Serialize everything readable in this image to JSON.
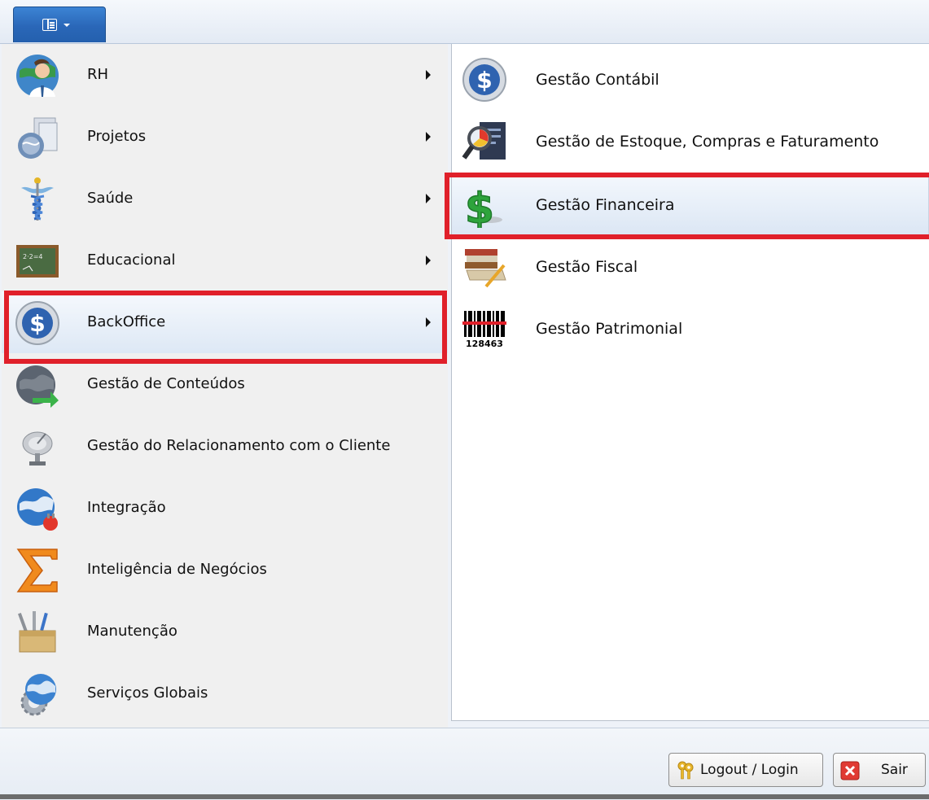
{
  "main_menu": {
    "items": [
      {
        "label": "RH",
        "icon": "rh-person-globe-icon",
        "has_submenu": true
      },
      {
        "label": "Projetos",
        "icon": "projetos-globe-documents-icon",
        "has_submenu": true
      },
      {
        "label": "Saúde",
        "icon": "saude-caduceus-icon",
        "has_submenu": true
      },
      {
        "label": "Educacional",
        "icon": "educacional-chalkboard-icon",
        "has_submenu": true
      },
      {
        "label": "BackOffice",
        "icon": "backoffice-dollar-icon",
        "has_submenu": true,
        "selected": true
      },
      {
        "label": "Gestão de Conteúdos",
        "icon": "conteudos-globe-arrow-icon",
        "has_submenu": false
      },
      {
        "label": "Gestão do Relacionamento com o Cliente",
        "icon": "crm-satellite-dish-icon",
        "has_submenu": false
      },
      {
        "label": "Integração",
        "icon": "integracao-globe-plug-icon",
        "has_submenu": false
      },
      {
        "label": "Inteligência de Negócios",
        "icon": "sigma-icon",
        "has_submenu": false
      },
      {
        "label": "Manutenção",
        "icon": "toolbox-icon",
        "has_submenu": false
      },
      {
        "label": "Serviços Globais",
        "icon": "globe-gear-icon",
        "has_submenu": false
      }
    ]
  },
  "submenu": {
    "items": [
      {
        "label": "Gestão Contábil",
        "icon": "dollar-coin-icon"
      },
      {
        "label": "Gestão de Estoque, Compras e Faturamento",
        "icon": "report-magnifier-icon"
      },
      {
        "label": "Gestão Financeira",
        "icon": "green-dollar-icon",
        "selected": true
      },
      {
        "label": "Gestão Fiscal",
        "icon": "books-pen-icon"
      },
      {
        "label": "Gestão Patrimonial",
        "icon": "barcode-icon",
        "barcode_text": "128463"
      }
    ]
  },
  "footer": {
    "logout_label": "Logout / Login",
    "exit_label": "Sair"
  },
  "colors": {
    "highlight": "#e0202a",
    "menu_button": "#2a67b8"
  }
}
